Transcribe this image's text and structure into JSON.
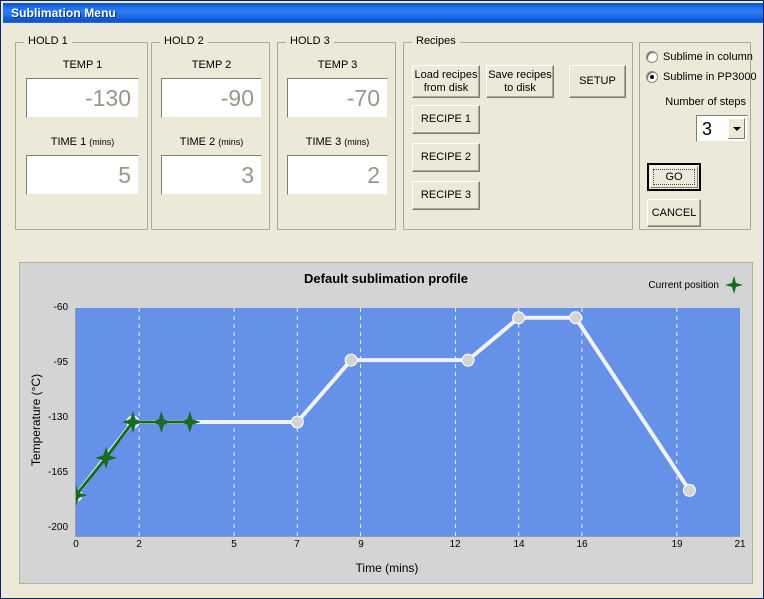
{
  "window": {
    "title": "Sublimation Menu"
  },
  "holds": [
    {
      "group_label": "HOLD 1",
      "temp_label": "TEMP 1",
      "temp_value": "-130",
      "time_label": "TIME 1",
      "time_units": "(mins)",
      "time_value": "5"
    },
    {
      "group_label": "HOLD 2",
      "temp_label": "TEMP 2",
      "temp_value": "-90",
      "time_label": "TIME 2",
      "time_units": "(mins)",
      "time_value": "3"
    },
    {
      "group_label": "HOLD 3",
      "temp_label": "TEMP 3",
      "temp_value": "-70",
      "time_label": "TIME 3",
      "time_units": "(mins)",
      "time_value": "2"
    }
  ],
  "recipes": {
    "group_label": "Recipes",
    "load_button": "Load recipes\nfrom disk",
    "save_button": "Save recipes\nto disk",
    "setup_button": "SETUP",
    "recipe_buttons": [
      "RECIPE 1",
      "RECIPE 2",
      "RECIPE 3"
    ]
  },
  "options": {
    "radio_column_label": "Sublime in column",
    "radio_column_checked": false,
    "radio_pp3000_label": "Sublime in PP3000",
    "radio_pp3000_checked": true,
    "steps_label": "Number of steps",
    "steps_value": "3",
    "go_button": "GO",
    "cancel_button": "CANCEL"
  },
  "colors": {
    "titlebar_blue": "#1767E8",
    "panel_beige": "#ECE9D8",
    "chart_bg": "#D4D4D4",
    "plot_blue": "#6591E8",
    "profile_line": "#F2F2F2",
    "profile_marker": "#D4D4D4",
    "current_position": "#176B23"
  },
  "chart_data": {
    "type": "line",
    "title": "Default sublimation profile",
    "xlabel": "Time (mins)",
    "ylabel": "Temperature (°C)",
    "xlim": [
      0,
      21
    ],
    "ylim": [
      -200,
      -60
    ],
    "xticks": [
      0,
      2,
      5,
      7,
      9,
      12,
      14,
      16,
      19,
      21
    ],
    "yticks": [
      -60,
      -95,
      -130,
      -165,
      -200
    ],
    "grid": "vertical-dashed",
    "legend": {
      "position": "top-right",
      "entries": [
        {
          "label": "Current position",
          "marker": "green-four-point-star",
          "color": "#176B23"
        }
      ]
    },
    "series": [
      {
        "name": "Default sublimation profile",
        "color": "#F2F2F2",
        "marker": "circle",
        "marker_color": "#D4D4D4",
        "points": [
          {
            "x": 0,
            "y": -175
          },
          {
            "x": 1.8,
            "y": -130
          },
          {
            "x": 7,
            "y": -130
          },
          {
            "x": 8.7,
            "y": -92
          },
          {
            "x": 12.4,
            "y": -92
          },
          {
            "x": 14,
            "y": -66
          },
          {
            "x": 15.8,
            "y": -66
          },
          {
            "x": 19.4,
            "y": -172
          }
        ]
      },
      {
        "name": "Current position",
        "color": "#176B23",
        "marker": "four-point-star",
        "marker_color": "#176B23",
        "points": [
          {
            "x": 0,
            "y": -175
          },
          {
            "x": 0.95,
            "y": -152
          },
          {
            "x": 1.8,
            "y": -130
          },
          {
            "x": 2.7,
            "y": -130
          },
          {
            "x": 3.6,
            "y": -130
          }
        ]
      }
    ]
  }
}
